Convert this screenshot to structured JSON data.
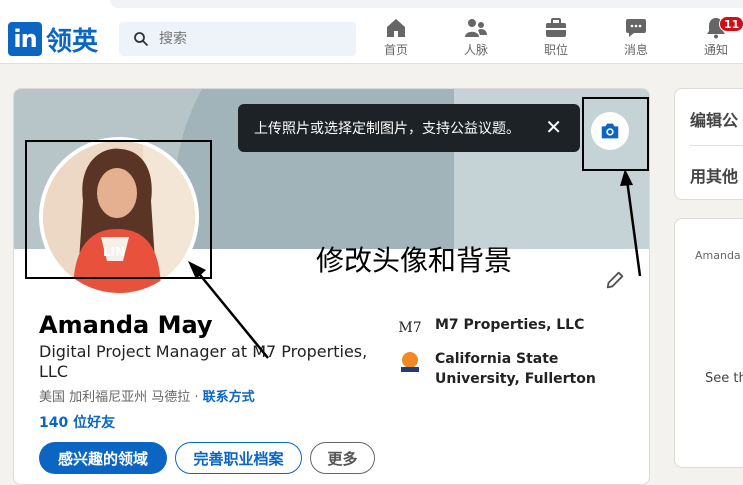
{
  "header": {
    "logo_mark": "in",
    "logo_text": "领英",
    "search": {
      "placeholder": "搜索",
      "value": ""
    },
    "nav": [
      {
        "label": "首页",
        "icon": "home-icon"
      },
      {
        "label": "人脉",
        "icon": "people-icon"
      },
      {
        "label": "职位",
        "icon": "briefcase-icon"
      },
      {
        "label": "消息",
        "icon": "message-icon"
      },
      {
        "label": "通知",
        "icon": "bell-icon",
        "badge": "11"
      }
    ]
  },
  "banner": {
    "tooltip": "上传照片或选择定制图片，支持公益议题。",
    "close_glyph": "✕"
  },
  "annotation": {
    "text": "修改头像和背景"
  },
  "profile": {
    "name": "Amanda May",
    "headline": "Digital Project Manager at M7 Properties, LLC",
    "location": "美国 加利福尼亚州 马德拉 · ",
    "contact_link": "联系方式",
    "connections": "140 位好友",
    "buttons": {
      "open_to": "感兴趣的领域",
      "add_section": "完善职业档案",
      "more": "更多"
    },
    "orgs": [
      {
        "name": "M7 Properties, LLC",
        "logo_text": "M7"
      },
      {
        "name": "California State University, Fullerton",
        "logo_text": ""
      }
    ]
  },
  "sidebar": {
    "edit_profile": "编辑公",
    "other_lang": "用其他",
    "card2_small": "Amanda",
    "card2_see": "See th"
  },
  "colors": {
    "brand": "#0a66c2",
    "badge": "#cc1016",
    "banner": "#b7c5c9",
    "tooltip_bg": "#1d2226"
  }
}
